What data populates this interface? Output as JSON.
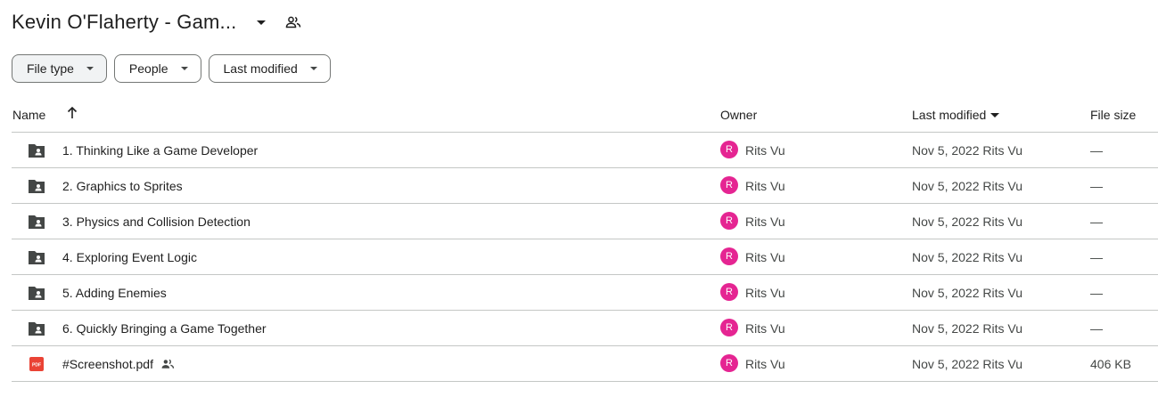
{
  "header": {
    "title": "Kevin O'Flaherty - Gam..."
  },
  "filters": [
    {
      "label": "File type",
      "active": true
    },
    {
      "label": "People",
      "active": false
    },
    {
      "label": "Last modified",
      "active": false
    }
  ],
  "columns": {
    "name": "Name",
    "owner": "Owner",
    "last_modified": "Last modified",
    "file_size": "File size"
  },
  "rows": [
    {
      "name": "1. Thinking Like a Game Developer",
      "icon": "shared-folder-icon",
      "owner_initial": "R",
      "owner": "Rits Vu",
      "modified": "Nov 5, 2022 Rits Vu",
      "size": "—",
      "shared": false
    },
    {
      "name": "2. Graphics to Sprites",
      "icon": "shared-folder-icon",
      "owner_initial": "R",
      "owner": "Rits Vu",
      "modified": "Nov 5, 2022 Rits Vu",
      "size": "—",
      "shared": false
    },
    {
      "name": "3. Physics and Collision Detection",
      "icon": "shared-folder-icon",
      "owner_initial": "R",
      "owner": "Rits Vu",
      "modified": "Nov 5, 2022 Rits Vu",
      "size": "—",
      "shared": false
    },
    {
      "name": "4. Exploring Event Logic",
      "icon": "shared-folder-icon",
      "owner_initial": "R",
      "owner": "Rits Vu",
      "modified": "Nov 5, 2022 Rits Vu",
      "size": "—",
      "shared": false
    },
    {
      "name": "5. Adding Enemies",
      "icon": "shared-folder-icon",
      "owner_initial": "R",
      "owner": "Rits Vu",
      "modified": "Nov 5, 2022 Rits Vu",
      "size": "—",
      "shared": false
    },
    {
      "name": "6. Quickly Bringing a Game Together",
      "icon": "shared-folder-icon",
      "owner_initial": "R",
      "owner": "Rits Vu",
      "modified": "Nov 5, 2022 Rits Vu",
      "size": "—",
      "shared": false
    },
    {
      "name": "#Screenshot.pdf",
      "icon": "pdf-icon",
      "owner_initial": "R",
      "owner": "Rits Vu",
      "modified": "Nov 5, 2022 Rits Vu",
      "size": "406 KB",
      "shared": true
    }
  ],
  "colors": {
    "avatar": "#e52592",
    "folder": "#444746",
    "pdf": "#ea4335"
  }
}
